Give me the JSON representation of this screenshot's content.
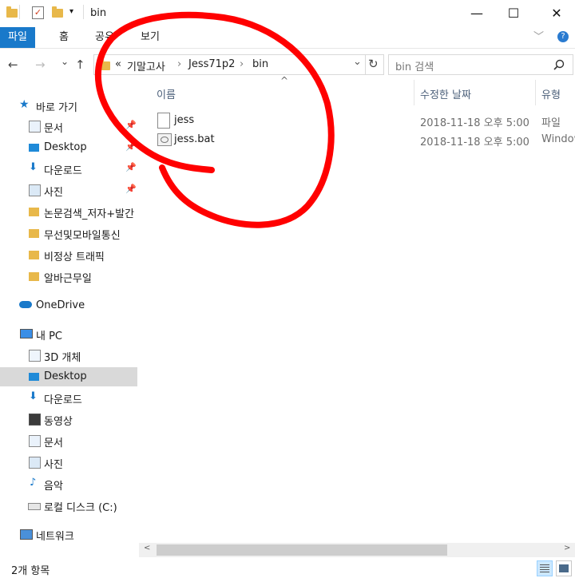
{
  "window": {
    "title": "bin",
    "minimize": "—",
    "maximize": "☐",
    "close": "✕"
  },
  "ribbon": {
    "tabs": [
      "파일",
      "홈",
      "공유",
      "보기"
    ],
    "expand": "﹀",
    "help": "?"
  },
  "address": {
    "overflow": "«",
    "crumbs": [
      "기말고사",
      "Jess71p2",
      "bin"
    ],
    "separator": "›",
    "dropdown": "⌄",
    "refresh": "↻"
  },
  "search": {
    "placeholder": "bin 검색",
    "icon": "search-icon"
  },
  "nav": {
    "back": "←",
    "forward": "→",
    "recent": "⌄",
    "up": "↑",
    "quick_access": "바로 가기",
    "quick_items": [
      {
        "label": "문서",
        "pinned": true
      },
      {
        "label": "Desktop",
        "pinned": true
      },
      {
        "label": "다운로드",
        "pinned": true
      },
      {
        "label": "사진",
        "pinned": true
      },
      {
        "label": "논문검색_저자+발간"
      },
      {
        "label": "무선및모바일통신"
      },
      {
        "label": "비정상 트래픽"
      },
      {
        "label": "알바근무일"
      }
    ],
    "onedrive": "OneDrive",
    "this_pc": "내 PC",
    "pc_items": [
      "3D 개체",
      "Desktop",
      "다운로드",
      "동영상",
      "문서",
      "사진",
      "음악",
      "로컬 디스크 (C:)"
    ],
    "network": "네트워크",
    "pin_glyph": "📌"
  },
  "columns": {
    "name": "이름",
    "date": "수정한 날짜",
    "type": "유형",
    "sort": "^"
  },
  "files": [
    {
      "name": "jess",
      "date": "2018-11-18 오후 5:00",
      "type": "파일"
    },
    {
      "name": "jess.bat",
      "date": "2018-11-18 오후 5:00",
      "type": "Window"
    }
  ],
  "status": {
    "count": "2개 항목"
  },
  "scroll": {
    "left": "<",
    "right": ">"
  },
  "colors": {
    "accent": "#1979ca",
    "selected": "#d9d9d9",
    "folder": "#e8b84a",
    "annotation": "#ff0000"
  }
}
